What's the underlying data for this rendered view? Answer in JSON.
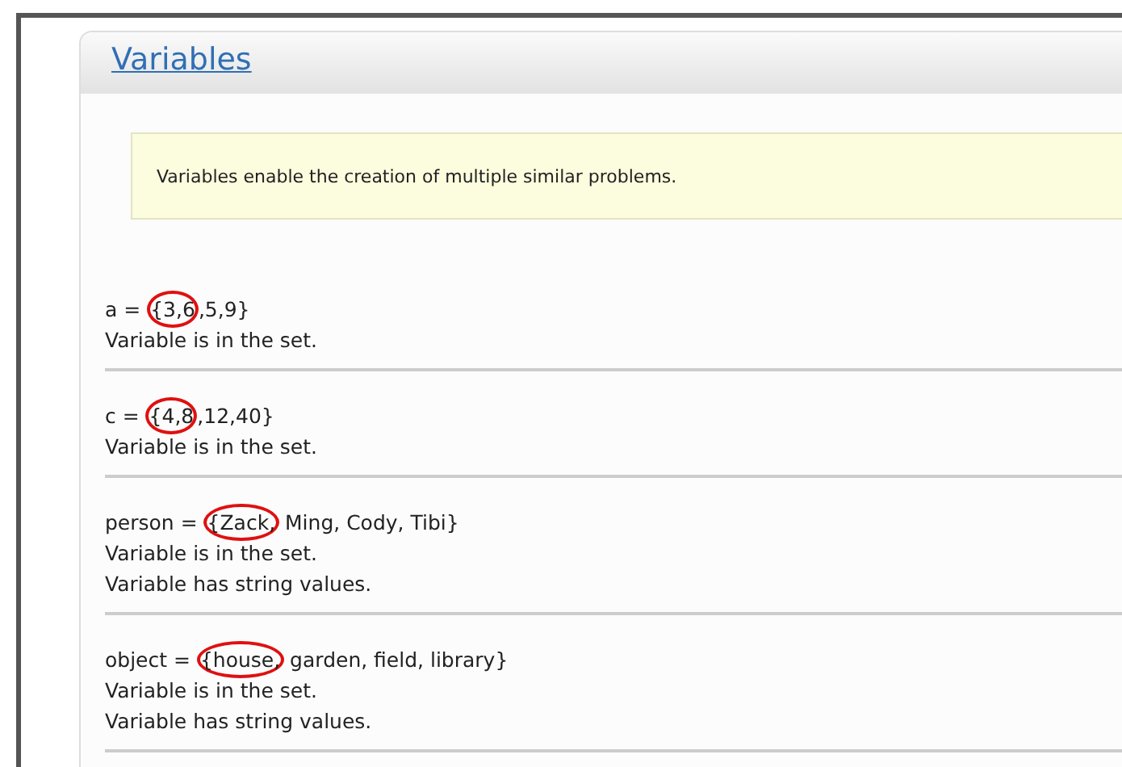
{
  "panel": {
    "title": "Variables"
  },
  "note": "Variables enable the creation of multiple similar problems.",
  "variables": [
    {
      "prefix": "a =",
      "circled": "{3,6",
      "rest": ",5,9}",
      "notes": [
        "Variable is in the set."
      ]
    },
    {
      "prefix": "c =",
      "circled": "{4,8",
      "rest": ",12,40}",
      "notes": [
        "Variable is in the set."
      ]
    },
    {
      "prefix": "person =",
      "circled": "{Zack,",
      "rest": " Ming, Cody, Tibi}",
      "notes": [
        "Variable is in the set.",
        "Variable has string values."
      ]
    },
    {
      "prefix": "object =",
      "circled": "{house,",
      "rest": " garden, field, library}",
      "notes": [
        "Variable is in the set.",
        "Variable has string values."
      ]
    }
  ]
}
